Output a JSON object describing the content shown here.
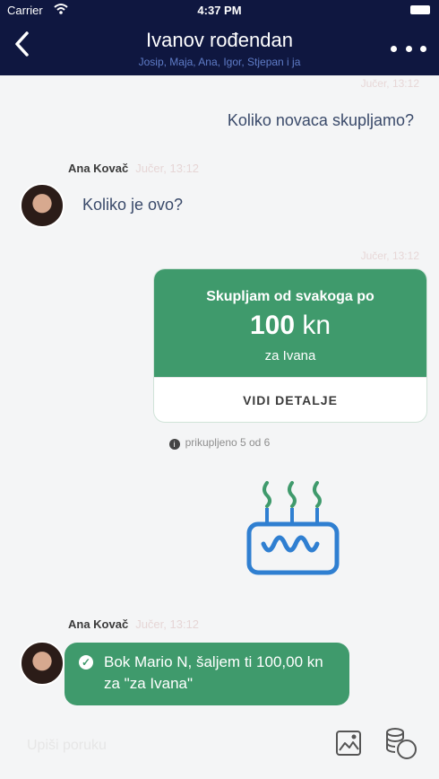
{
  "status": {
    "carrier": "Carrier",
    "time": "4:37 PM"
  },
  "header": {
    "title": "Ivanov rođendan",
    "subtitle": "Josip, Maja, Ana, Igor, Stjepan i ja"
  },
  "messages": {
    "top_timestamp": "Jučer, 13:12",
    "outgoing_text": "Koliko novaca skupljamo?",
    "sender_1": {
      "name": "Ana Kovač",
      "timestamp": "Jučer, 13:12"
    },
    "incoming_text": "Koliko je ovo?",
    "card_timestamp": "Jučer, 13:12",
    "card": {
      "title": "Skupljam od svakoga po",
      "amount": "100",
      "currency": "kn",
      "purpose": "za Ivana",
      "button": "VIDI DETALJE"
    },
    "collected": "prikupljeno 5 od 6",
    "sender_2": {
      "name": "Ana Kovač",
      "timestamp": "Jučer, 13:12"
    },
    "payment_text": "Bok Mario N, šaljem ti 100,00 kn za \"za Ivana\""
  },
  "composer": {
    "placeholder": "Upiši poruku"
  },
  "colors": {
    "navy": "#0f1740",
    "green": "#3f9a6c",
    "blue": "#2f7fd1"
  }
}
